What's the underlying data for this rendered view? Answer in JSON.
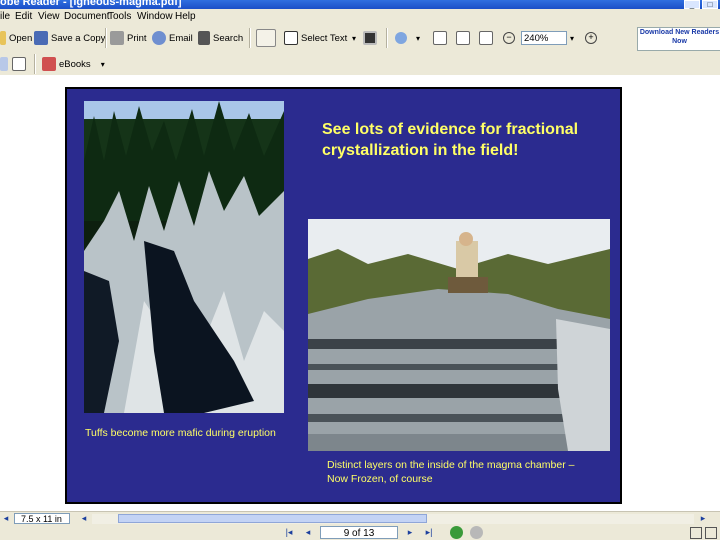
{
  "window": {
    "title": "obe Reader - [igneous-magma.pdf]"
  },
  "menu": [
    "ile",
    "Edit",
    "View",
    "Document",
    "Tools",
    "Window",
    "Help"
  ],
  "toolbar": {
    "open_label": "Open",
    "save_copy_label": "Save a Copy",
    "print_label": "Print",
    "email_label": "Email",
    "search_label": "Search",
    "select_text_label": "Select Text",
    "zoom_value": "240%",
    "download_label": "Download New Readers Now"
  },
  "toolbar2": {
    "ebooks_label": "eBooks"
  },
  "slide": {
    "heading": "See lots of evidence for fractional crystallization in the field!",
    "caption_left": "Tuffs become more mafic during eruption",
    "caption_right_line1": "Distinct layers on the inside of the magma chamber –",
    "caption_right_line2": "Now Frozen, of course"
  },
  "status": {
    "page_size": "7.5 x 11 in",
    "page_indicator": "9 of 13"
  },
  "colors": {
    "slide_bg": "#2b2b8f",
    "slide_text": "#ffff66",
    "chrome_bg": "#ece9d8",
    "title_bar": "#1b4fc7"
  }
}
